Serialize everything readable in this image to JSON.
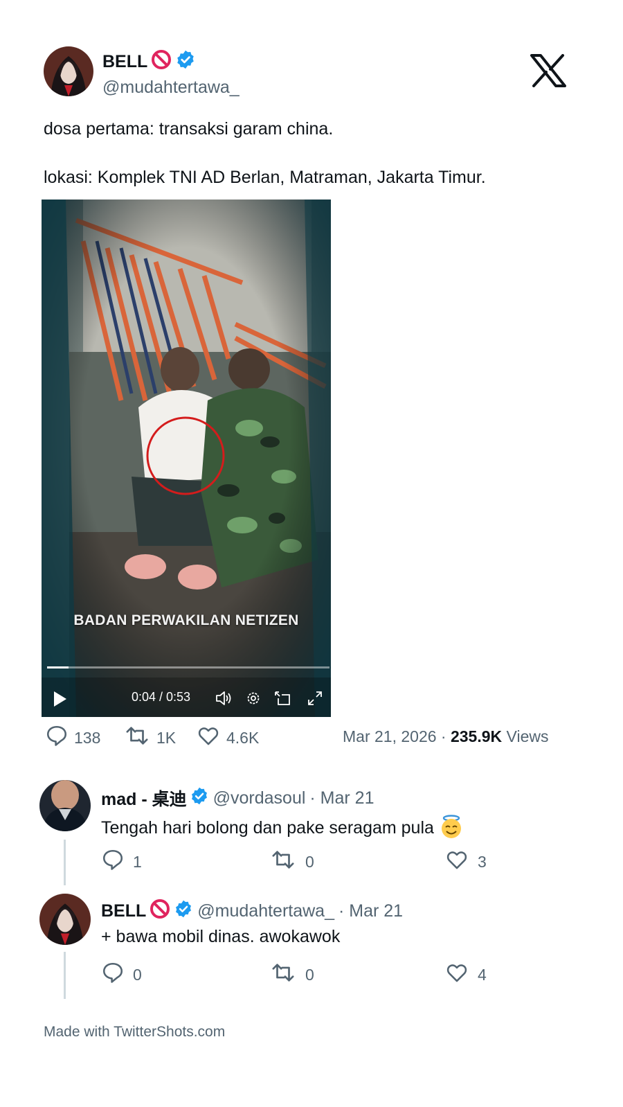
{
  "tweet": {
    "author_name": "BELL",
    "author_handle": "@mudahtertawa_",
    "text_line1": "dosa pertama: transaksi garam china.",
    "text_line2": "lokasi: Komplek TNI AD Berlan, Matraman, Jakarta Timur.",
    "video": {
      "caption": "BADAN PERWAKILAN NETIZEN",
      "time": "0:04 / 0:53",
      "progress": 0.075
    },
    "stats": {
      "replies": "138",
      "retweets": "1K",
      "likes": "4.6K"
    },
    "date": "Mar 21, 2026 · ",
    "views_count": "235.9K",
    "views_label": " Views"
  },
  "replies": [
    {
      "name": "mad - 桌迪",
      "handle": "@vordasoul",
      "date": "· Mar 21",
      "text": "Tengah hari bolong dan pake seragam pula",
      "emoji": "😇",
      "replies": "1",
      "retweets": "0",
      "likes": "3"
    },
    {
      "name": "BELL",
      "handle": "@mudahtertawa_",
      "date": "· Mar 21",
      "text": "+ bawa mobil dinas. awokawok",
      "replies": "0",
      "retweets": "0",
      "likes": "4"
    }
  ],
  "footer": "Made with TwitterShots.com",
  "colors": {
    "verified": "#1d9bf0",
    "muted": "#536471",
    "prohibited": "#e0245e",
    "thread_line": "#cfd9de"
  },
  "icons": [
    "x-logo-icon",
    "verified-badge-icon",
    "prohibited-icon",
    "reply-icon",
    "retweet-icon",
    "like-icon",
    "play-icon",
    "volume-icon",
    "settings-icon",
    "pip-icon",
    "fullscreen-icon"
  ]
}
